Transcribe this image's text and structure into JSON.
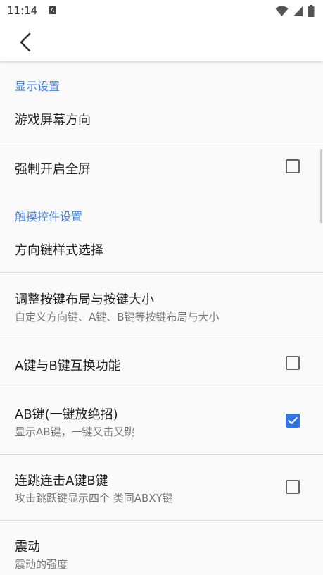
{
  "status_bar": {
    "time": "11:14",
    "notification_icon": "A",
    "icons": [
      "wifi-icon",
      "signal-icon",
      "battery-icon"
    ]
  },
  "app_bar": {
    "back_icon": "chevron-left-icon"
  },
  "settings": {
    "display_header": "显示设置",
    "screen_orientation": {
      "title": "游戏屏幕方向"
    },
    "force_fullscreen": {
      "title": "强制开启全屏",
      "checked": false
    },
    "touch_header": "触摸控件设置",
    "dpad_style": {
      "title": "方向键样式选择"
    },
    "adjust_layout": {
      "title": "调整按键布局与按键大小",
      "summary": "自定义方向键、A键、B键等按键布局与大小"
    },
    "swap_ab": {
      "title": "A键与B键互换功能",
      "checked": false
    },
    "ab_key": {
      "title": "AB键(一键放绝招)",
      "summary": "显示AB键，一键又击又跳",
      "checked": true
    },
    "turbo": {
      "title": "连跳连击A键B键",
      "summary": "攻击跳跃键显示四个 类同ABXY键",
      "checked": false
    },
    "vibration": {
      "title": "震动",
      "summary": "震动的强度"
    }
  },
  "colors": {
    "accent": "#2f74e0",
    "category": "#4a84d6",
    "summary_text": "#757575"
  }
}
